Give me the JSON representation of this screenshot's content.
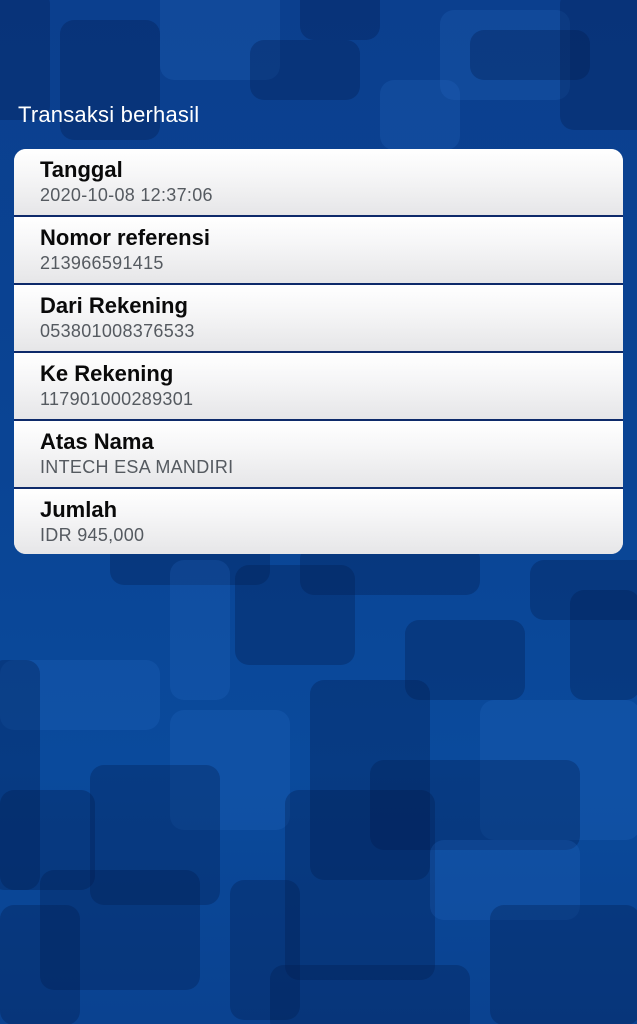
{
  "header": {
    "title": "Transaksi berhasil"
  },
  "details": [
    {
      "label": "Tanggal",
      "value": "2020-10-08 12:37:06"
    },
    {
      "label": "Nomor referensi",
      "value": "213966591415"
    },
    {
      "label": "Dari Rekening",
      "value": "053801008376533"
    },
    {
      "label": "Ke Rekening",
      "value": "117901000289301"
    },
    {
      "label": "Atas Nama",
      "value": "INTECH ESA MANDIRI"
    },
    {
      "label": "Jumlah",
      "value": "IDR 945,000"
    }
  ],
  "colors": {
    "background": "#0a4494",
    "card": "#f4f4f5",
    "divider": "#0e2a6a",
    "label": "#0a0a0a",
    "value": "#555a60"
  }
}
